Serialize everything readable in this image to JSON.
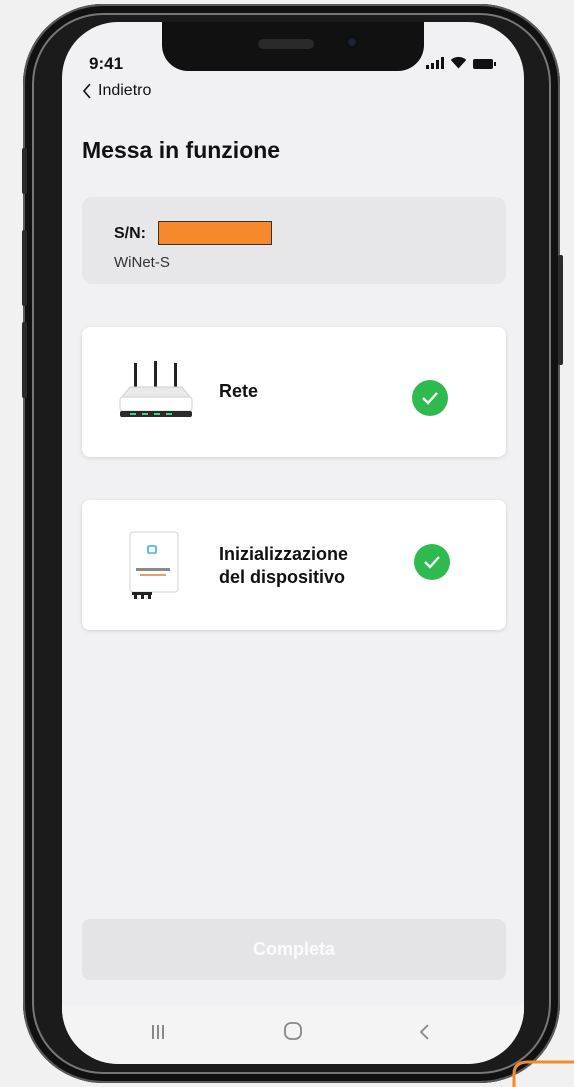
{
  "status_bar": {
    "time": "9:41"
  },
  "header": {
    "back_label": "Indietro",
    "title": "Messa in funzione"
  },
  "device": {
    "sn_label": "S/N:",
    "model": "WiNet-S"
  },
  "steps": [
    {
      "label": "Rete",
      "status": "complete"
    },
    {
      "label_line1": "Inizializzazione",
      "label_line2": "del dispositivo",
      "status": "complete"
    }
  ],
  "footer": {
    "complete_label": "Completa"
  },
  "colors": {
    "success": "#2dbb4f",
    "redaction": "#f5892c",
    "button_disabled": "#e4e4e6"
  },
  "icons": {
    "back": "chevron-left-icon",
    "network": "router-icon",
    "device": "inverter-device-icon",
    "check": "check-circle-icon",
    "nav": [
      "recent-apps-icon",
      "home-icon",
      "back-icon"
    ]
  }
}
